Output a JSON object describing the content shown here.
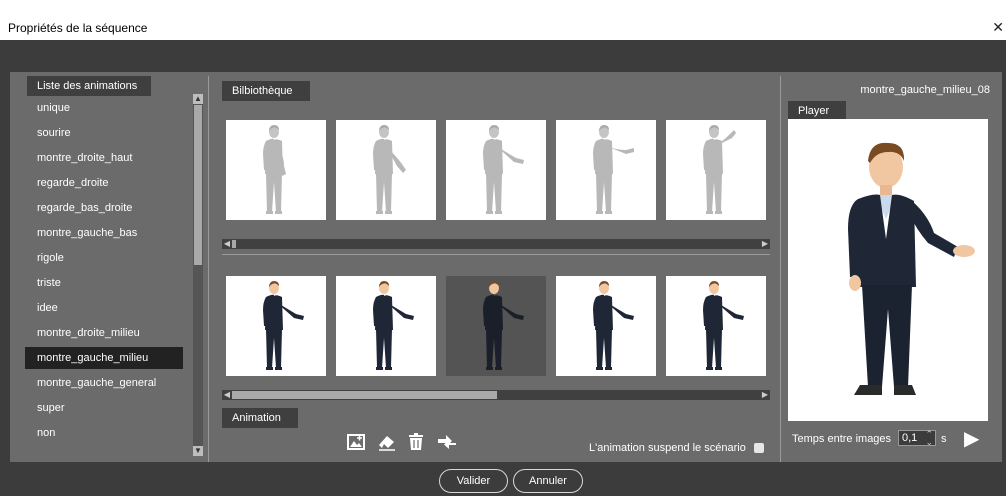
{
  "window": {
    "title": "Propriétés de la séquence",
    "close_glyph": "✕"
  },
  "animation_list": {
    "header": "Liste des animations",
    "items": [
      "unique",
      "sourire",
      "montre_droite_haut",
      "regarde_droite",
      "regarde_bas_droite",
      "montre_gauche_bas",
      "rigole",
      "triste",
      "idee",
      "montre_droite_milieu",
      "montre_gauche_milieu",
      "montre_gauche_general",
      "super",
      "non"
    ],
    "selected": "montre_gauche_milieu"
  },
  "library": {
    "header": "Bilbiothèque",
    "frame_count": 5
  },
  "animation": {
    "header": "Animation",
    "frame_count": 5,
    "selected_frame_index": 3,
    "suspend_label": "L'animation suspend le scénario",
    "tool_icons": [
      "image-edit-icon",
      "eraser-icon",
      "trash-icon",
      "swap-icon"
    ]
  },
  "player": {
    "header": "Player",
    "current_frame_name": "montre_gauche_milieu_08",
    "interval_label": "Temps entre images",
    "interval_value": "0,1",
    "interval_unit": "s",
    "play_glyph": "▶"
  },
  "buttons": {
    "ok": "Valider",
    "cancel": "Annuler"
  },
  "colors": {
    "background": "#3c3c3c",
    "panel": "#6b6b6b",
    "selected": "#222222",
    "tab": "#3f3f3f"
  }
}
